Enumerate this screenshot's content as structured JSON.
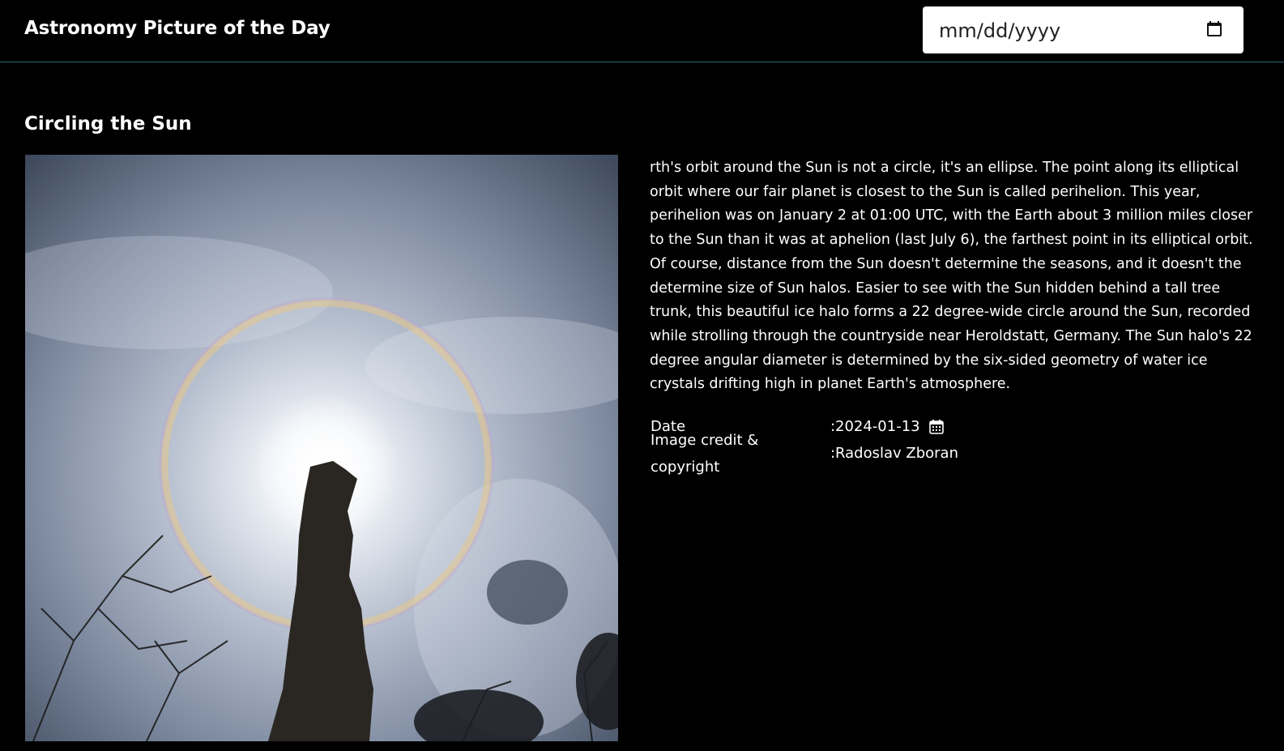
{
  "header": {
    "title": "Astronomy Picture of the Day",
    "date_placeholder": "mm/dd/yyyy",
    "date_icon": "calendar-icon"
  },
  "apod": {
    "title": "Circling the Sun",
    "explanation": "rth's orbit around the Sun is not a circle, it's an ellipse. The point along its elliptical orbit where our fair planet is closest to the Sun is called perihelion. This year, perihelion was on January 2 at 01:00 UTC, with the Earth about 3 million miles closer to the Sun than it was at aphelion (last July 6), the farthest point in its elliptical orbit. Of course, distance from the Sun doesn't determine the seasons, and it doesn't the determine size of Sun halos. Easier to see with the Sun hidden behind a tall tree trunk, this beautiful ice halo forms a 22 degree-wide circle around the Sun, recorded while strolling through the countryside near Heroldstatt, Germany. The Sun halo's 22 degree angular diameter is determined by the six-sided geometry of water ice crystals drifting high in planet Earth's atmosphere.",
    "date_label": "Date",
    "date_value": "2024-01-13",
    "credit_label": "Image credit & copyright",
    "credit_value": "Radoslav Zboran",
    "separator": ":"
  },
  "colors": {
    "background": "#000000",
    "header_border": "#1f6f7a",
    "text": "#ffffff"
  }
}
